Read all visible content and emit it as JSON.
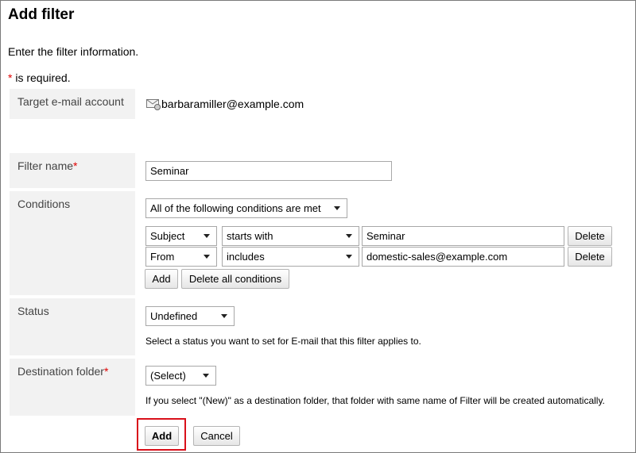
{
  "page": {
    "title": "Add filter",
    "intro": "Enter the filter information.",
    "required_mark": "*",
    "required_note": " is required."
  },
  "form": {
    "target_account": {
      "label": "Target e-mail account",
      "value": "barbaramiller@example.com",
      "icon": "mail-icon"
    },
    "filter_name": {
      "label": "Filter name",
      "value": "Seminar"
    },
    "conditions": {
      "label": "Conditions",
      "match_mode": "All of the following conditions are met",
      "rows": [
        {
          "field": "Subject",
          "operator": "starts with",
          "value": "Seminar",
          "delete_label": "Delete"
        },
        {
          "field": "From",
          "operator": "includes",
          "value": "domestic-sales@example.com",
          "delete_label": "Delete"
        }
      ],
      "add_label": "Add",
      "delete_all_label": "Delete all conditions"
    },
    "status": {
      "label": "Status",
      "value": "Undefined",
      "help": "Select a status you want to set for E-mail that this filter applies to."
    },
    "destination": {
      "label": "Destination folder",
      "value": "(Select)",
      "help": "If you select \"(New)\" as a destination folder, that folder with same name of Filter will be created automatically."
    }
  },
  "actions": {
    "add_label": "Add",
    "cancel_label": "Cancel"
  },
  "colors": {
    "required": "#e00000",
    "highlight": "#d9101a",
    "label_bg": "#f2f2f2"
  }
}
